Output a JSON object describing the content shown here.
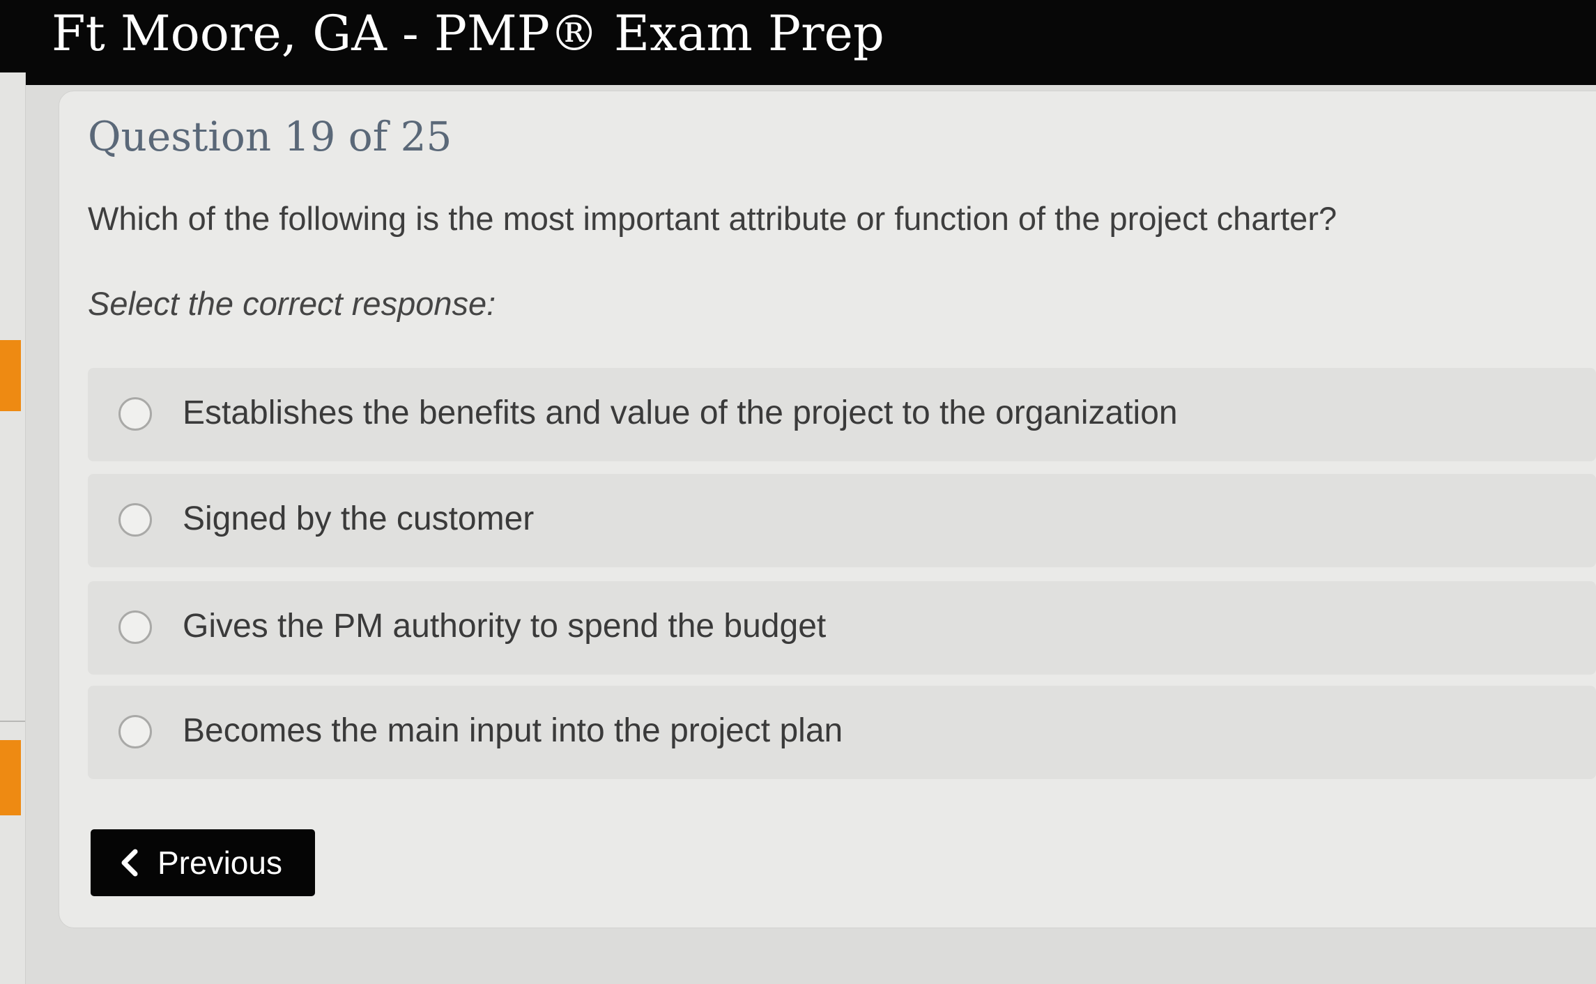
{
  "header": {
    "title": "Ft Moore, GA - PMP® Exam Prep"
  },
  "question": {
    "number_label": "Question 19 of 25",
    "current": 19,
    "total": 25,
    "text": "Which of the following is the most important attribute or function of the project charter?",
    "instruction": "Select the correct response:",
    "options": [
      {
        "label": "Establishes the benefits and value of the project to the organization",
        "selected": false
      },
      {
        "label": "Signed by the customer",
        "selected": false
      },
      {
        "label": "Gives the PM authority to spend the budget",
        "selected": false
      },
      {
        "label": "Becomes the main input into the project plan",
        "selected": false
      }
    ]
  },
  "navigation": {
    "previous_label": "Previous",
    "previous_icon": "chevron-left-icon"
  },
  "colors": {
    "header_bg": "#070707",
    "accent_marker": "#ee8a12",
    "question_number": "#5a6878",
    "button_bg": "#050505"
  }
}
